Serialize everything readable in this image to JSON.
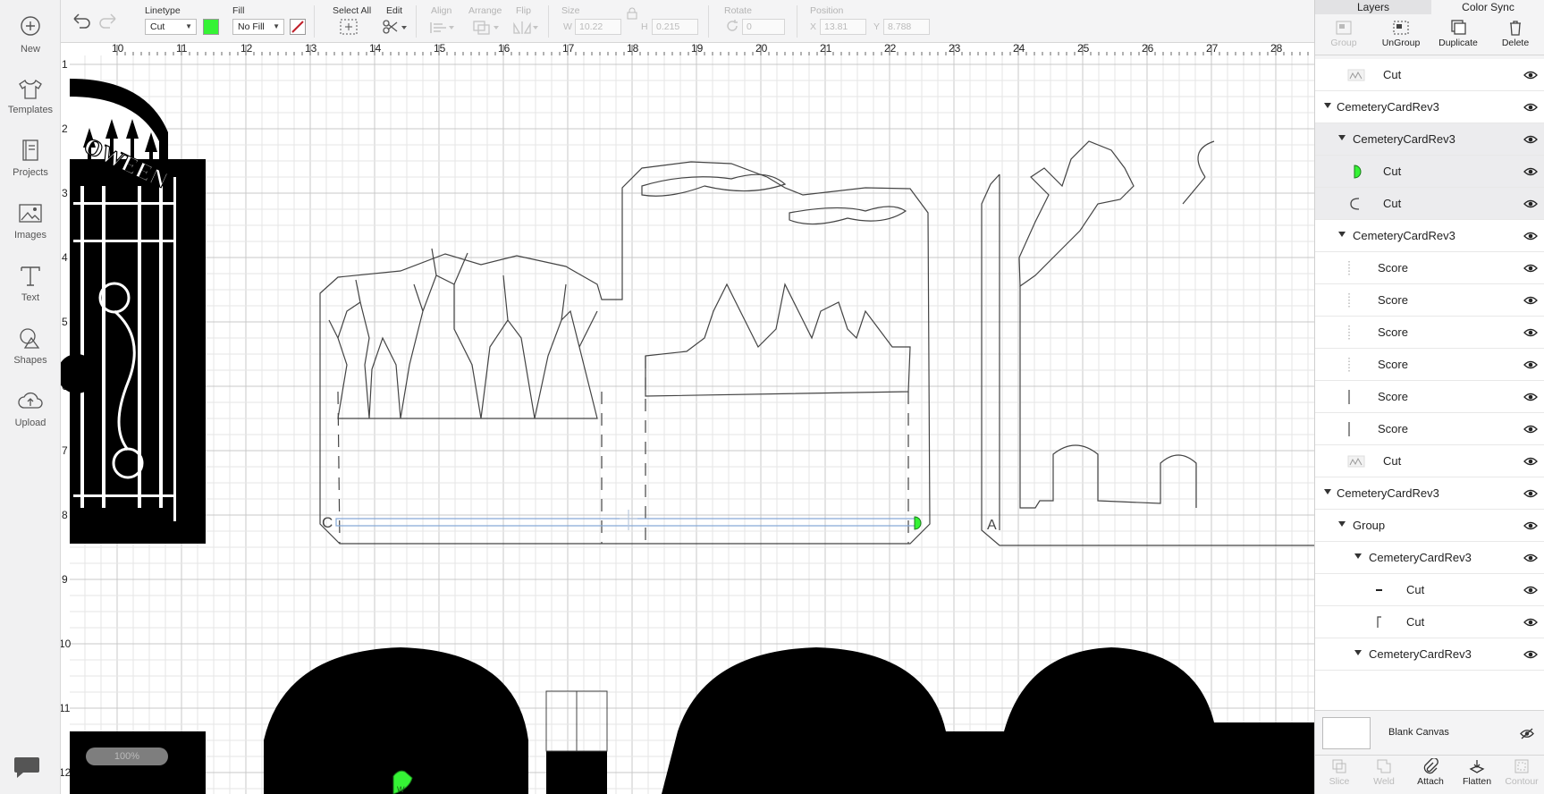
{
  "sidebar": {
    "items": [
      {
        "label": "New",
        "icon": "plus-circle-icon"
      },
      {
        "label": "Templates",
        "icon": "tshirt-icon"
      },
      {
        "label": "Projects",
        "icon": "book-icon"
      },
      {
        "label": "Images",
        "icon": "image-icon"
      },
      {
        "label": "Text",
        "icon": "text-t-icon"
      },
      {
        "label": "Shapes",
        "icon": "shapes-icon"
      },
      {
        "label": "Upload",
        "icon": "cloud-upload-icon"
      }
    ]
  },
  "toolbar": {
    "linetype_label": "Linetype",
    "linetype_value": "Cut",
    "linetype_color": "#35f335",
    "fill_label": "Fill",
    "fill_value": "No Fill",
    "select_all_label": "Select All",
    "edit_label": "Edit",
    "align_label": "Align",
    "arrange_label": "Arrange",
    "flip_label": "Flip",
    "size_label": "Size",
    "size_w_label": "W",
    "size_w_value": "10.22",
    "size_h_label": "H",
    "size_h_value": "0.215",
    "rotate_label": "Rotate",
    "rotate_value": "0",
    "position_label": "Position",
    "pos_x_label": "X",
    "pos_x_value": "13.81",
    "pos_y_label": "Y",
    "pos_y_value": "8.788"
  },
  "canvas": {
    "ruler_top": [
      "10",
      "11",
      "12",
      "13",
      "14",
      "15",
      "16",
      "17",
      "18",
      "19",
      "20",
      "21",
      "22",
      "23",
      "24",
      "25",
      "26",
      "27",
      "28"
    ],
    "ruler_left": [
      "1",
      "2",
      "3",
      "4",
      "5",
      "6",
      "7",
      "8",
      "9",
      "10",
      "11",
      "12"
    ],
    "gate_text": "OWEEN",
    "panel_letters": [
      "C",
      "A"
    ],
    "marker_letter": "W",
    "zoom_label": "100%"
  },
  "layers_panel": {
    "tabs": [
      "Layers",
      "Color Sync"
    ],
    "tools": [
      {
        "label": "Group",
        "enabled": false
      },
      {
        "label": "UnGroup",
        "enabled": true
      },
      {
        "label": "Duplicate",
        "enabled": true
      },
      {
        "label": "Delete",
        "enabled": true
      }
    ],
    "rows": [
      {
        "name": "Cut",
        "level": 1,
        "toggle": false,
        "thumb": "image"
      },
      {
        "name": "CemeteryCardRev3",
        "level": 0,
        "toggle": true
      },
      {
        "name": "CemeteryCardRev3",
        "level": 1,
        "toggle": true,
        "highlight": true
      },
      {
        "name": "Cut",
        "level": 2,
        "toggle": false,
        "thumb": "green-half",
        "highlight": true
      },
      {
        "name": "Cut",
        "level": 2,
        "toggle": false,
        "thumb": "c-letter",
        "highlight": true
      },
      {
        "name": "CemeteryCardRev3",
        "level": 1,
        "toggle": true
      },
      {
        "name": "Score",
        "level": 3,
        "toggle": false,
        "thumb": "dots"
      },
      {
        "name": "Score",
        "level": 3,
        "toggle": false,
        "thumb": "dots"
      },
      {
        "name": "Score",
        "level": 3,
        "toggle": false,
        "thumb": "dots"
      },
      {
        "name": "Score",
        "level": 3,
        "toggle": false,
        "thumb": "dots"
      },
      {
        "name": "Score",
        "level": 3,
        "toggle": false,
        "thumb": "line"
      },
      {
        "name": "Score",
        "level": 3,
        "toggle": false,
        "thumb": "line"
      },
      {
        "name": "Cut",
        "level": 1,
        "toggle": false,
        "thumb": "image"
      },
      {
        "name": "CemeteryCardRev3",
        "level": 0,
        "toggle": true
      },
      {
        "name": "Group",
        "level": 1,
        "toggle": true
      },
      {
        "name": "CemeteryCardRev3",
        "level": 2,
        "toggle": true
      },
      {
        "name": "Cut",
        "level": 4,
        "toggle": false,
        "thumb": "dash"
      },
      {
        "name": "Cut",
        "level": 4,
        "toggle": false,
        "thumb": "corner"
      },
      {
        "name": "CemeteryCardRev3",
        "level": 2,
        "toggle": true
      }
    ],
    "blank_canvas_label": "Blank Canvas",
    "bottom_tools": [
      {
        "label": "Slice",
        "enabled": false
      },
      {
        "label": "Weld",
        "enabled": false
      },
      {
        "label": "Attach",
        "enabled": true
      },
      {
        "label": "Flatten",
        "enabled": true
      },
      {
        "label": "Contour",
        "enabled": false
      }
    ]
  }
}
